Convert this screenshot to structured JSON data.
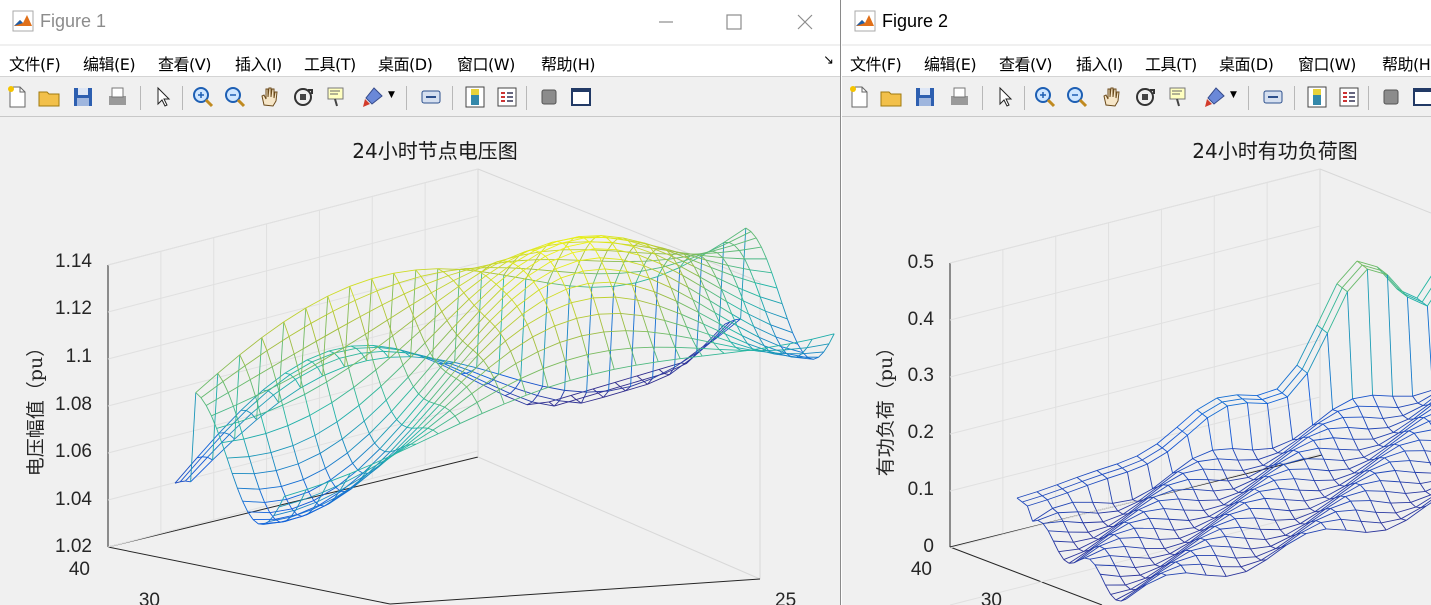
{
  "windows": [
    {
      "title": "Figure 1",
      "active": false,
      "menu": [
        "文件(F)",
        "编辑(E)",
        "查看(V)",
        "插入(I)",
        "工具(T)",
        "桌面(D)",
        "窗口(W)",
        "帮助(H)"
      ],
      "toolbar_icons": [
        "new-figure-icon",
        "open-file-icon",
        "save-icon",
        "print-icon",
        "pointer-icon",
        "zoom-in-icon",
        "zoom-out-icon",
        "pan-icon",
        "rotate-3d-icon",
        "data-cursor-icon",
        "brush-icon",
        "link-plot-icon",
        "colorbar-icon",
        "legend-icon",
        "hide-plot-tools-icon",
        "show-plot-tools-icon"
      ],
      "chart_data": {
        "type": "surface-mesh",
        "title": "24小时节点电压图",
        "zlabel": "电压幅值（pu）",
        "zticks": [
          "1.02",
          "1.04",
          "1.06",
          "1.08",
          "1.1",
          "1.12",
          "1.14"
        ],
        "ylim_ticks": [
          "40",
          "30"
        ],
        "xlim_ticks": [
          "25"
        ],
        "zlim": [
          1.02,
          1.14
        ],
        "colormap": "parula",
        "grid": true
      }
    },
    {
      "title": "Figure 2",
      "active": true,
      "menu": [
        "文件(F)",
        "编辑(E)",
        "查看(V)",
        "插入(I)",
        "工具(T)",
        "桌面(D)",
        "窗口(W)",
        "帮助(H)"
      ],
      "toolbar_icons": [
        "new-figure-icon",
        "open-file-icon",
        "save-icon",
        "print-icon",
        "pointer-icon",
        "zoom-in-icon",
        "zoom-out-icon",
        "pan-icon",
        "rotate-3d-icon",
        "data-cursor-icon",
        "brush-icon",
        "link-plot-icon",
        "colorbar-icon",
        "legend-icon",
        "hide-plot-tools-icon",
        "show-plot-tools-icon"
      ],
      "chart_data": {
        "type": "surface-mesh",
        "title": "24小时有功负荷图",
        "zlabel": "有功负荷（pu）",
        "zticks": [
          "0",
          "0.1",
          "0.2",
          "0.3",
          "0.4",
          "0.5"
        ],
        "ylim_ticks": [
          "40",
          "30"
        ],
        "zlim": [
          0,
          0.5
        ],
        "colormap": "parula",
        "grid": true
      }
    }
  ],
  "colors": {
    "matlab_orange": "#e0701a",
    "window_bg": "#f0f0f0",
    "mesh_low": "#352a87",
    "mesh_mid": "#21b6a5",
    "mesh_high": "#f9fb0e"
  }
}
